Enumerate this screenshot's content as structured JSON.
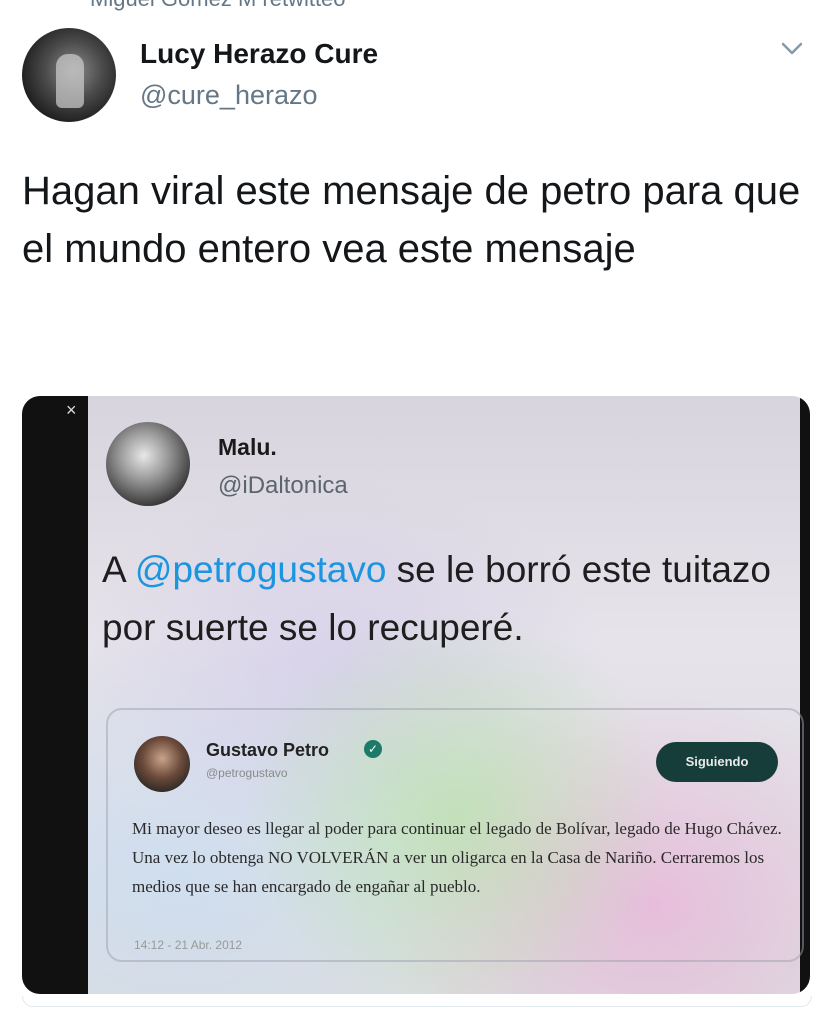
{
  "retweet": {
    "text": "Miguel Gómez M retwitteó"
  },
  "author": {
    "name": "Lucy Herazo Cure",
    "handle": "@cure_herazo"
  },
  "tweet": {
    "text": "Hagan viral este mensaje de petro para que el mundo entero vea este mensaje"
  },
  "media": {
    "close_label": "×",
    "inner_tweet": {
      "name": "Malu.",
      "handle": "@iDaltonica",
      "text_mention": "@petrogustavo",
      "text_before": "A ",
      "text_after": " se le borró este tuitazo por suerte se lo recuperé."
    },
    "quoted": {
      "name": "Gustavo Petro",
      "handle": "@petrogustavo",
      "follow_label": "Siguiendo",
      "text": "Mi mayor deseo es llegar al poder para continuar el legado de Bolívar, legado de Hugo Chávez. Una vez lo obtenga NO VOLVERÁN a ver un oligarca en la Casa de Nariño. Cerraremos los medios que se han encargado de engañar al pueblo.",
      "date": "14:12 - 21 Abr. 2012"
    }
  },
  "icons": {
    "menu": "chevron-down-icon",
    "verified": "verified-badge-icon"
  },
  "colors": {
    "link": "#1b95e0",
    "follow_button": "#163d3a"
  }
}
